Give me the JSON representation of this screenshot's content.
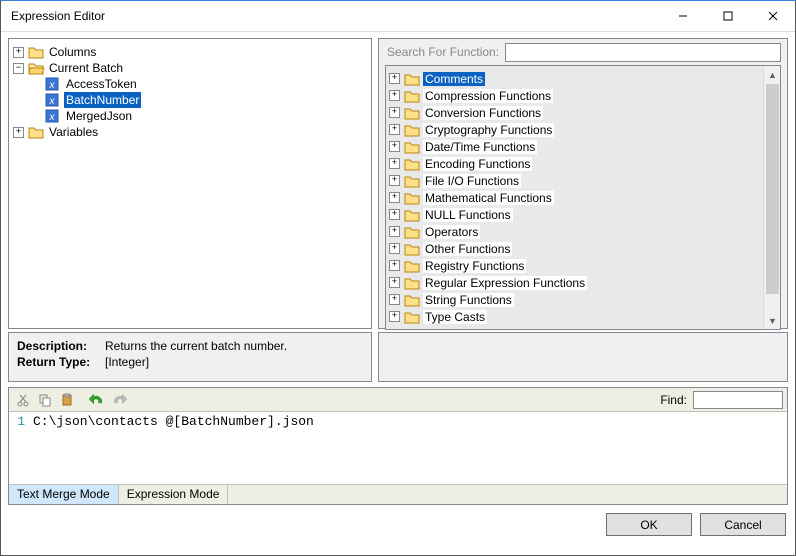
{
  "window": {
    "title": "Expression Editor"
  },
  "left_tree": {
    "columns": {
      "label": "Columns",
      "expanded": false
    },
    "current_batch": {
      "label": "Current Batch",
      "expanded": true,
      "items": [
        {
          "label": "AccessToken",
          "selected": false
        },
        {
          "label": "BatchNumber",
          "selected": true
        },
        {
          "label": "MergedJson",
          "selected": false
        }
      ]
    },
    "variables": {
      "label": "Variables",
      "expanded": false
    }
  },
  "search": {
    "label": "Search For Function:",
    "value": ""
  },
  "function_categories": [
    {
      "label": "Comments",
      "selected": true
    },
    {
      "label": "Compression Functions"
    },
    {
      "label": "Conversion Functions"
    },
    {
      "label": "Cryptography Functions"
    },
    {
      "label": "Date/Time Functions"
    },
    {
      "label": "Encoding Functions"
    },
    {
      "label": "File I/O Functions"
    },
    {
      "label": "Mathematical Functions"
    },
    {
      "label": "NULL Functions"
    },
    {
      "label": "Operators"
    },
    {
      "label": "Other Functions"
    },
    {
      "label": "Registry Functions"
    },
    {
      "label": "Regular Expression Functions"
    },
    {
      "label": "String Functions"
    },
    {
      "label": "Type Casts"
    }
  ],
  "description": {
    "key1": "Description:",
    "val1": "Returns the current batch number.",
    "key2": "Return Type:",
    "val2": "[Integer]"
  },
  "find": {
    "label": "Find:",
    "value": ""
  },
  "code": {
    "line_no": "1",
    "text": "C:\\json\\contacts @[BatchNumber].json"
  },
  "tabs": {
    "text_merge": "Text Merge Mode",
    "expression": "Expression Mode"
  },
  "buttons": {
    "ok": "OK",
    "cancel": "Cancel"
  },
  "glyphs": {
    "plus": "+",
    "minus": "−",
    "min": "—",
    "max": "☐",
    "close": "✕",
    "up": "▲",
    "down": "▼"
  }
}
